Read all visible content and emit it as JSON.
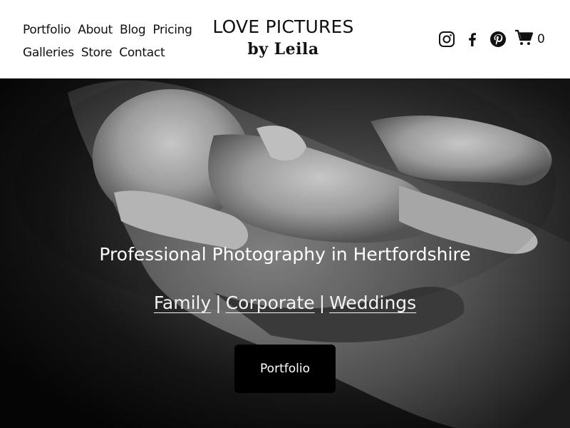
{
  "nav": {
    "items": [
      {
        "label": "Portfolio"
      },
      {
        "label": "About"
      },
      {
        "label": "Blog"
      },
      {
        "label": "Pricing"
      },
      {
        "label": "Galleries"
      },
      {
        "label": "Store"
      },
      {
        "label": "Contact"
      }
    ]
  },
  "logo": {
    "line1": "LOVE PICTURES",
    "line2": "by Leila"
  },
  "social": {
    "icons": [
      "instagram-icon",
      "facebook-icon",
      "pinterest-icon"
    ]
  },
  "cart": {
    "count": "0",
    "icon": "cart-icon"
  },
  "hero": {
    "headline": "Professional Photography in Hertfordshire",
    "links": [
      {
        "label": "Family"
      },
      {
        "label": "Corporate"
      },
      {
        "label": "Weddings"
      }
    ],
    "separator": "|",
    "button_label": "Portfolio"
  },
  "colors": {
    "header_bg": "#ffffff",
    "text_dark": "#111111",
    "hero_text": "#ffffff",
    "button_bg": "#000000"
  }
}
